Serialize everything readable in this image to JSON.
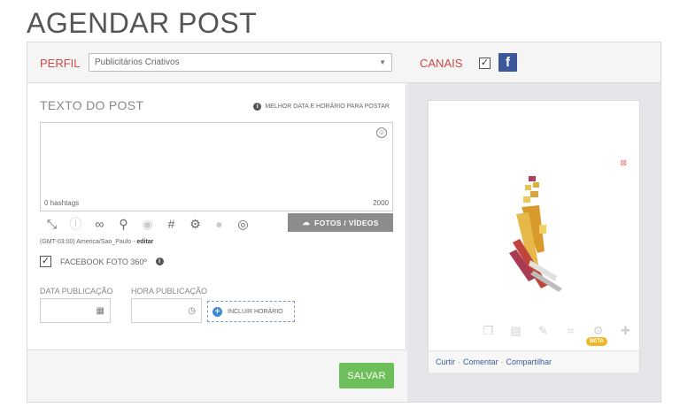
{
  "page": {
    "title": "AGENDAR POST"
  },
  "perfil": {
    "label": "PERFIL",
    "selected": "Publicitários Criativos"
  },
  "post": {
    "label": "TEXTO DO POST",
    "best_time": "MELHOR DATA E HORÁRIO PARA POSTAR",
    "hashtags": "0 hashtags",
    "counter": "2000",
    "fotos_button": "FOTOS / VÍDEOS",
    "timezone": "(GMT-03:00) America/Sao_Paulo -",
    "timezone_edit": "editar",
    "facebook_360": "FACEBOOK FOTO 360º"
  },
  "schedule": {
    "data_label": "DATA PUBLICAÇÃO",
    "hora_label": "HORA PUBLICAÇÃO",
    "incluir_label": "INCLUIR HORÁRIO"
  },
  "actions": {
    "salvar": "SALVAR"
  },
  "canais": {
    "label": "CANAIS",
    "facebook_checked": true,
    "fb_letter": "f"
  },
  "preview": {
    "beta": "BETA",
    "curtir": "Curtir",
    "comentar": "Comentar",
    "compartilhar": "Compartilhar",
    "sep": "·"
  },
  "colors": {
    "accent_red": "#d04848",
    "salvar_green": "#6dbf5a",
    "facebook_blue": "#3b5998"
  }
}
